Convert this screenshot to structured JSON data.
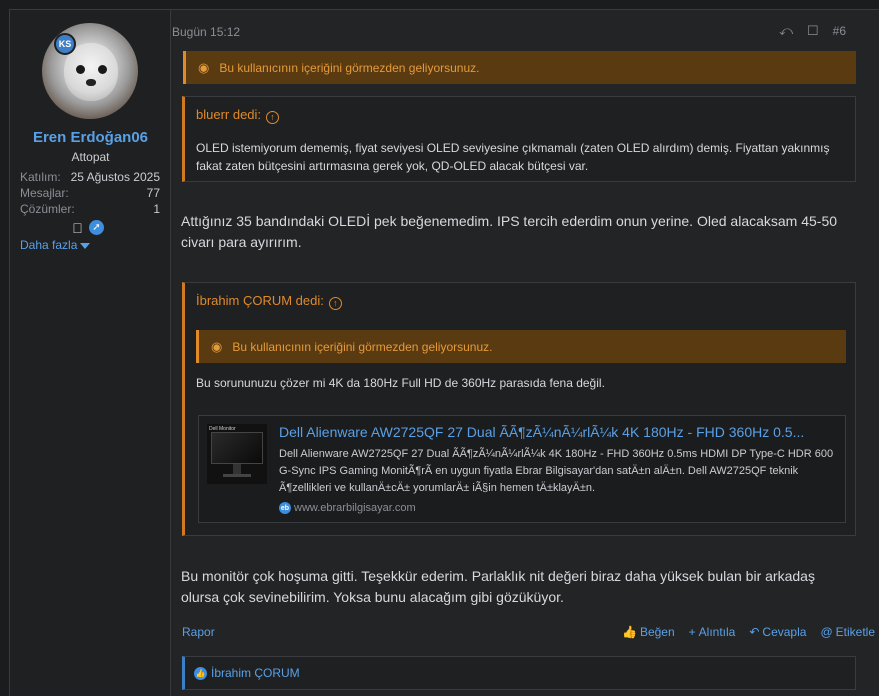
{
  "user": {
    "name": "Eren Erdoğan06",
    "title": "Attopat",
    "badge": "KS",
    "stats": [
      {
        "label": "Katılım:",
        "value": "25 Ağustos 2025"
      },
      {
        "label": "Mesajlar:",
        "value": "77"
      },
      {
        "label": "Çözümler:",
        "value": "1"
      }
    ],
    "more_label": "Daha fazla"
  },
  "post": {
    "time": "Bugün 15:12",
    "number": "#6",
    "ignored_notice": "Bu kullanıcının içeriğini görmezden geliyorsunuz.",
    "quote1": {
      "author": "bluerr dedi:",
      "body": "OLED istemiyorum dememiş, fiyat seviyesi OLED seviyesine çıkmamalı (zaten OLED alırdım) demiş. Fiyattan yakınmış fakat zaten bütçesini artırmasına gerek yok, QD-OLED alacak bütçesi var."
    },
    "message1": "Attığınız 35 bandındaki OLEDİ pek beğenemedim. IPS tercih ederdim onun yerine. Oled alacaksam 45-50 civarı para ayırırım.",
    "quote2": {
      "author": "İbrahim ÇORUM dedi:",
      "ignored_notice": "Bu kullanıcının içeriğini görmezden geliyorsunuz.",
      "body": "Bu sorununuzu çözer mi 4K da 180Hz Full HD de 360Hz parasıda fena değil.",
      "embed": {
        "title": "Dell Alienware AW2725QF 27 Dual ÃÃ¶zÃ¼nÃ¼rlÃ¼k 4K 180Hz - FHD 360Hz 0.5...",
        "desc": "Dell Alienware AW2725QF 27 Dual ÃÃ¶zÃ¼nÃ¼rlÃ¼k 4K 180Hz - FHD 360Hz 0.5ms HDMI DP Type-C HDR 600 G-Sync IPS Gaming MonitÃ¶rÃ en uygun fiyatla Ebrar Bilgisayar'dan satÄ±n alÄ±n. Dell AW2725QF teknik Ã¶zellikleri ve kullanÄ±cÄ± yorumlarÄ± iÃ§in hemen tÄ±klayÄ±n.",
        "site": "www.ebrarbilgisayar.com",
        "site_badge": "eb",
        "thumb_text": "Dell Monitor"
      }
    },
    "message2": "Bu monitör çok hoşuma gitti. Teşekkür ederim. Parlaklık nit değeri biraz daha yüksek bulan bir arkadaş olursa çok sevinebilirim. Yoksa bunu alacağım gibi gözüküyor.",
    "actions": {
      "report": "Rapor",
      "like": "Beğen",
      "quote": "Alıntıla",
      "reply": "Cevapla",
      "tag": "Etiketle"
    },
    "liked_by": "İbrahim ÇORUM"
  }
}
